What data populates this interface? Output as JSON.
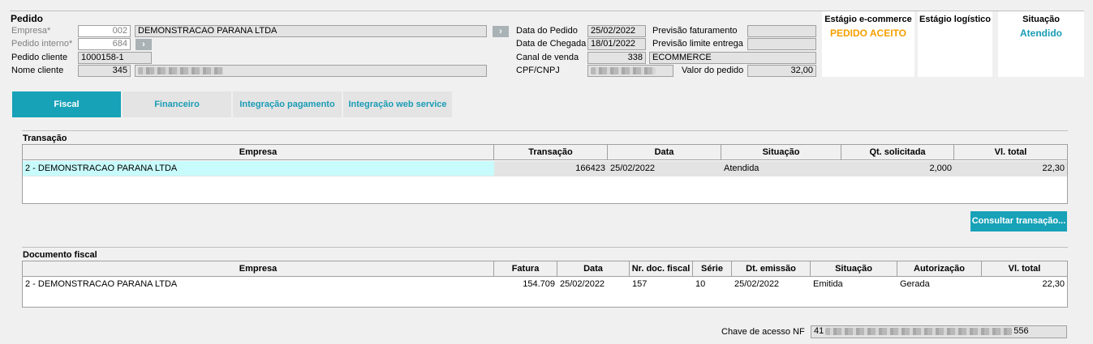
{
  "pedido": {
    "title": "Pedido",
    "empresa_label": "Empresa*",
    "empresa_code": "002",
    "empresa_name": "DEMONSTRACAO PARANA LTDA",
    "pedido_interno_label": "Pedido interno*",
    "pedido_interno_value": "684",
    "pedido_cliente_label": "Pedido cliente",
    "pedido_cliente_value": "1000158-1",
    "nome_cliente_label": "Nome cliente",
    "nome_cliente_code": "345",
    "data_pedido_label": "Data do Pedido",
    "data_pedido_value": "25/02/2022",
    "data_chegada_label": "Data de Chegada",
    "data_chegada_value": "18/01/2022",
    "canal_venda_label": "Canal de venda",
    "canal_venda_code": "338",
    "canal_venda_name": "ECOMMERCE",
    "cpf_label": "CPF/CNPJ",
    "previsao_fat_label": "Previsão faturamento",
    "previsao_limite_label": "Previsão limite entrega",
    "valor_pedido_label": "Valor do pedido",
    "valor_pedido_value": "32,00"
  },
  "stages": {
    "ecommerce_title": "Estágio e-commerce",
    "ecommerce_value": "PEDIDO ACEITO",
    "ecommerce_color": "#f5a000",
    "logistico_title": "Estágio logístico",
    "situacao_title": "Situação",
    "situacao_value": "Atendido",
    "situacao_color": "#1a9cb5"
  },
  "tabs": [
    "Fiscal",
    "Financeiro",
    "Integração pagamento",
    "Integração web service"
  ],
  "transacao": {
    "title": "Transação",
    "headers": [
      "Empresa",
      "Transação",
      "Data",
      "Situação",
      "Qt. solicitada",
      "Vl. total"
    ],
    "rows": [
      [
        "2 - DEMONSTRACAO PARANA LTDA",
        "166423",
        "25/02/2022",
        "Atendida",
        "2,000",
        "22,30"
      ]
    ],
    "button": "Consultar transação..."
  },
  "documento": {
    "title": "Documento fiscal",
    "headers": [
      "Empresa",
      "Fatura",
      "Data",
      "Nr. doc. fiscal",
      "Série",
      "Dt. emissão",
      "Situação",
      "Autorização",
      "Vl. total"
    ],
    "rows": [
      [
        "2 - DEMONSTRACAO PARANA LTDA",
        "154.709",
        "25/02/2022",
        "157",
        "10",
        "25/02/2022",
        "Emitida",
        "Gerada",
        "22,30"
      ]
    ],
    "chave_label": "Chave de acesso NF",
    "chave_prefix": "41",
    "chave_suffix": "556"
  }
}
